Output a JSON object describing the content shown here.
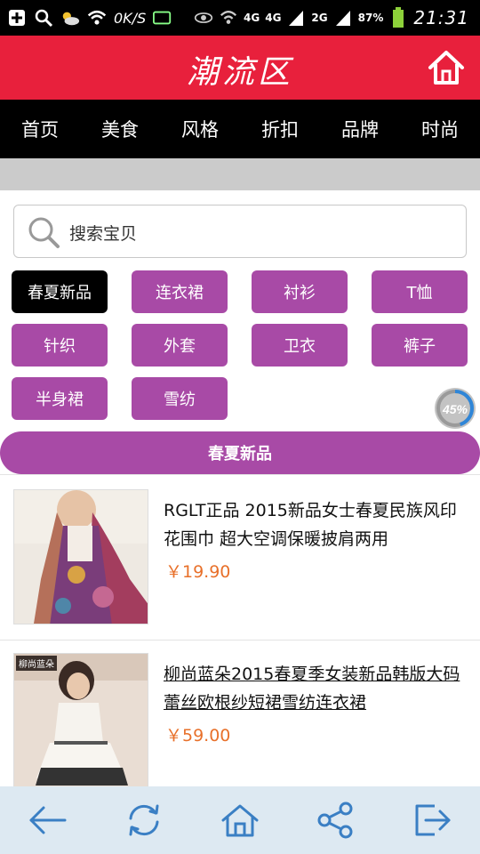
{
  "status_bar": {
    "speed": "0K/S",
    "net1": "4G",
    "net2": "4G",
    "net3": "2G",
    "battery": "87%",
    "time": "21:31"
  },
  "header": {
    "title": "潮流区"
  },
  "nav": [
    "首页",
    "美食",
    "风格",
    "折扣",
    "品牌",
    "时尚"
  ],
  "search": {
    "placeholder": "搜索宝贝"
  },
  "tags": [
    "春夏新品",
    "连衣裙",
    "衬衫",
    "T恤",
    "针织",
    "外套",
    "卫衣",
    "裤子",
    "半身裙",
    "雪纺"
  ],
  "active_tag": "春夏新品",
  "progress": {
    "label": "45%",
    "value": 0.45
  },
  "section_title": "春夏新品",
  "products": [
    {
      "name": "RGLT正品 2015新品女士春夏民族风印花围巾 超大空调保暖披肩两用",
      "price": "￥19.90"
    },
    {
      "name": "柳尚蓝朵2015春夏季女装新品韩版大码蕾丝欧根纱短裙雪纺连衣裙",
      "price": "￥59.00",
      "thumb_label": "柳尚蓝朵"
    }
  ],
  "toolbar": [
    "back-icon",
    "refresh-icon",
    "home-icon",
    "share-icon",
    "exit-icon"
  ],
  "colors": {
    "header": "#e8203c",
    "tag": "#a84aa6",
    "price": "#e8702a",
    "toolbar": "#dde9f2",
    "toolbar_icon": "#3a7fc4"
  }
}
